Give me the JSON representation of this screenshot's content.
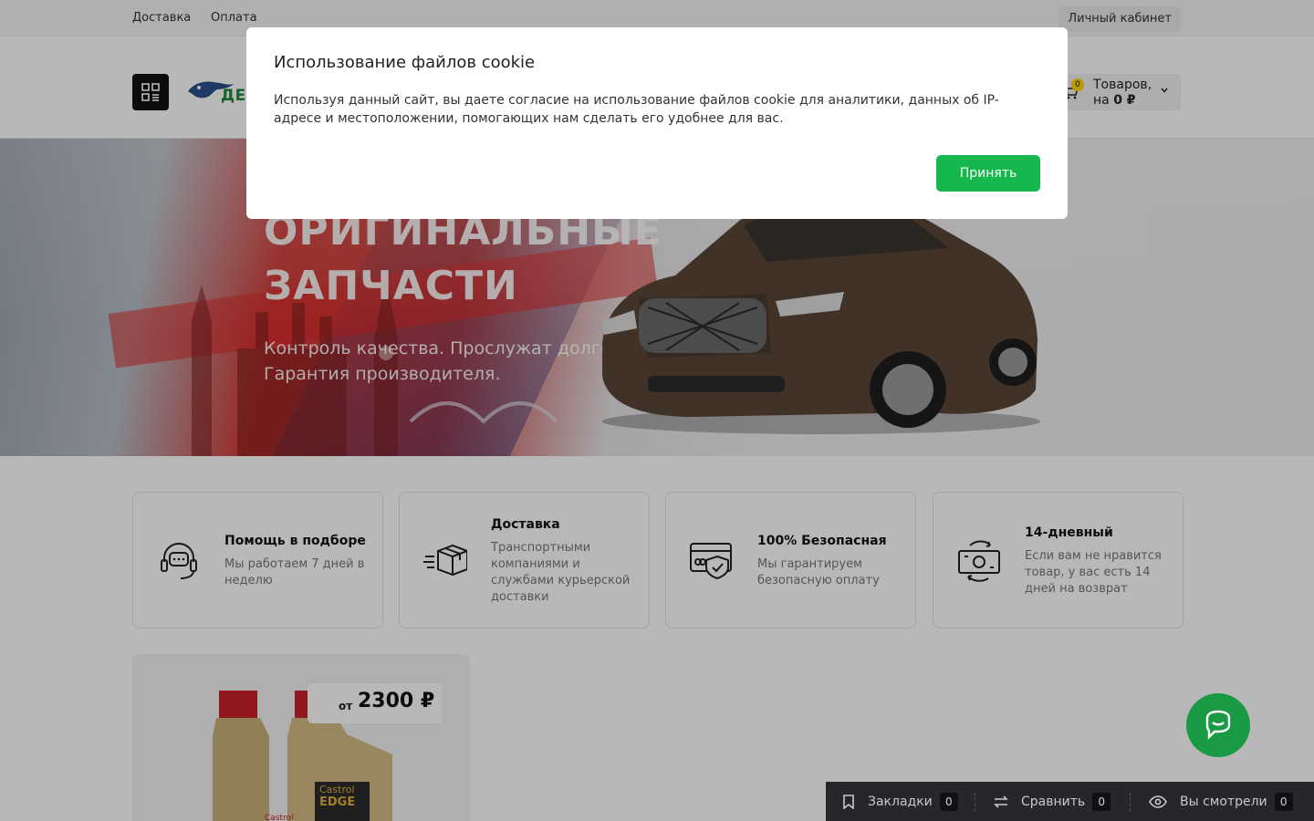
{
  "topbar": {
    "links": [
      "Доставка",
      "Оплата"
    ],
    "cabinet_label": "Личный кабинет"
  },
  "header": {
    "logo_text": "ДЕВ",
    "cart": {
      "count": "0",
      "line1": "Товаров,",
      "line2_prefix": "на ",
      "line2_value": "0 ₽"
    }
  },
  "hero": {
    "title_line1": "ОРИГИНАЛЬНЫЕ",
    "title_line2": "ЗАПЧАСТИ",
    "subtitle_line1": "Контроль качества. Прослужат долго.",
    "subtitle_line2": "Гарантия производителя."
  },
  "features": [
    {
      "icon": "headset-icon",
      "title": "Помощь в подборе",
      "text": "Мы работаем 7 дней в неделю"
    },
    {
      "icon": "delivery-box-icon",
      "title": "Доставка",
      "text": "Транспортными компаниями и службами курьерской доставки"
    },
    {
      "icon": "secure-card-icon",
      "title": "100% Безопасная",
      "text": "Мы гарантируем безопасную оплату"
    },
    {
      "icon": "money-return-icon",
      "title": "14-дневный",
      "text": "Если вам не нравится товар, у вас есть 14 дней на возврат"
    }
  ],
  "product": {
    "price_prefix": "от",
    "price_value": "2300 ₽"
  },
  "bottom_panel": {
    "items": [
      {
        "icon": "bookmark-icon",
        "label": "Закладки",
        "count": "0"
      },
      {
        "icon": "compare-icon",
        "label": "Сравнить",
        "count": "0"
      },
      {
        "icon": "eye-icon",
        "label": "Вы смотрели",
        "count": "0"
      }
    ]
  },
  "cookie_modal": {
    "title": "Использование файлов cookie",
    "text": "Используя данный сайт, вы даете согласие на использование файлов cookie для аналитики, данных об IP-адресе и местоположении, помогающих нам сделать его удобнее для вас.",
    "accept_label": "Принять"
  },
  "colors": {
    "accent_green": "#16b84e",
    "chat_green": "#1a9a45",
    "panel_dark": "#26262b"
  }
}
